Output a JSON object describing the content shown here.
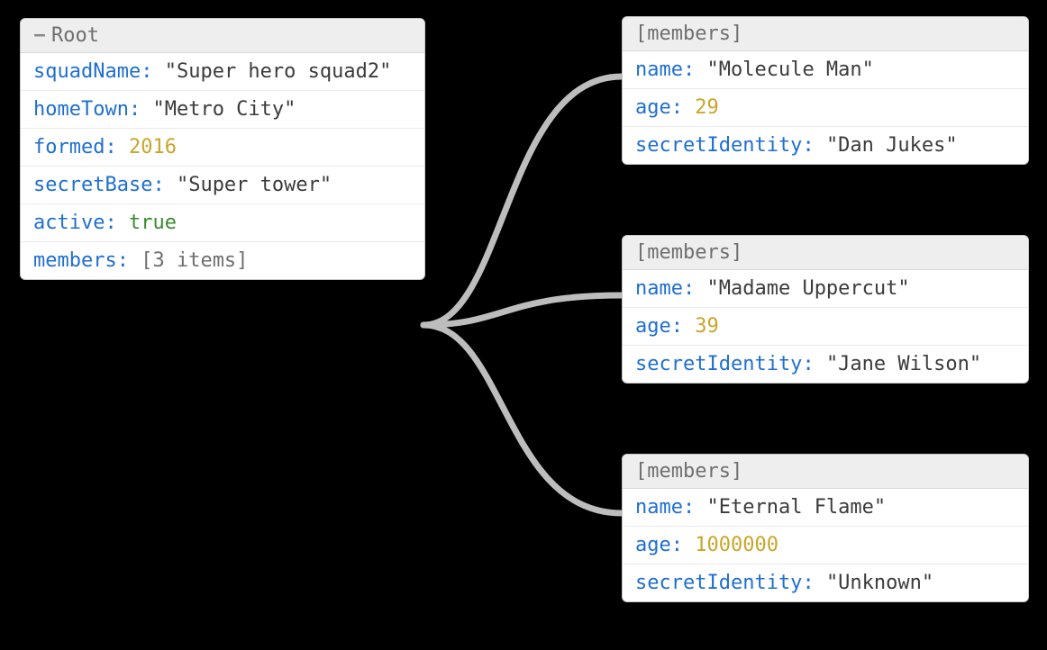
{
  "root": {
    "title": "Root",
    "toggle": "−",
    "fields": {
      "squadName": {
        "key": "squadName",
        "valueText": "\"Super hero squad2\"",
        "value": "Super hero squad2",
        "type": "string"
      },
      "homeTown": {
        "key": "homeTown",
        "valueText": "\"Metro City\"",
        "value": "Metro City",
        "type": "string"
      },
      "formed": {
        "key": "formed",
        "valueText": "2016",
        "value": 2016,
        "type": "number"
      },
      "secretBase": {
        "key": "secretBase",
        "valueText": "\"Super tower\"",
        "value": "Super tower",
        "type": "string"
      },
      "active": {
        "key": "active",
        "valueText": "true",
        "value": true,
        "type": "boolean"
      },
      "members": {
        "key": "members",
        "valueText": "[3 items]",
        "type": "array",
        "count": 3
      }
    }
  },
  "membersLabel": "[members]",
  "members": [
    {
      "name": {
        "key": "name",
        "valueText": "\"Molecule Man\"",
        "value": "Molecule Man",
        "type": "string"
      },
      "age": {
        "key": "age",
        "valueText": "29",
        "value": 29,
        "type": "number"
      },
      "secretIdentity": {
        "key": "secretIdentity",
        "valueText": "\"Dan Jukes\"",
        "value": "Dan Jukes",
        "type": "string"
      }
    },
    {
      "name": {
        "key": "name",
        "valueText": "\"Madame Uppercut\"",
        "value": "Madame Uppercut",
        "type": "string"
      },
      "age": {
        "key": "age",
        "valueText": "39",
        "value": 39,
        "type": "number"
      },
      "secretIdentity": {
        "key": "secretIdentity",
        "valueText": "\"Jane Wilson\"",
        "value": "Jane Wilson",
        "type": "string"
      }
    },
    {
      "name": {
        "key": "name",
        "valueText": "\"Eternal Flame\"",
        "value": "Eternal Flame",
        "type": "string"
      },
      "age": {
        "key": "age",
        "valueText": "1000000",
        "value": 1000000,
        "type": "number"
      },
      "secretIdentity": {
        "key": "secretIdentity",
        "valueText": "\"Unknown\"",
        "value": "Unknown",
        "type": "string"
      }
    }
  ]
}
